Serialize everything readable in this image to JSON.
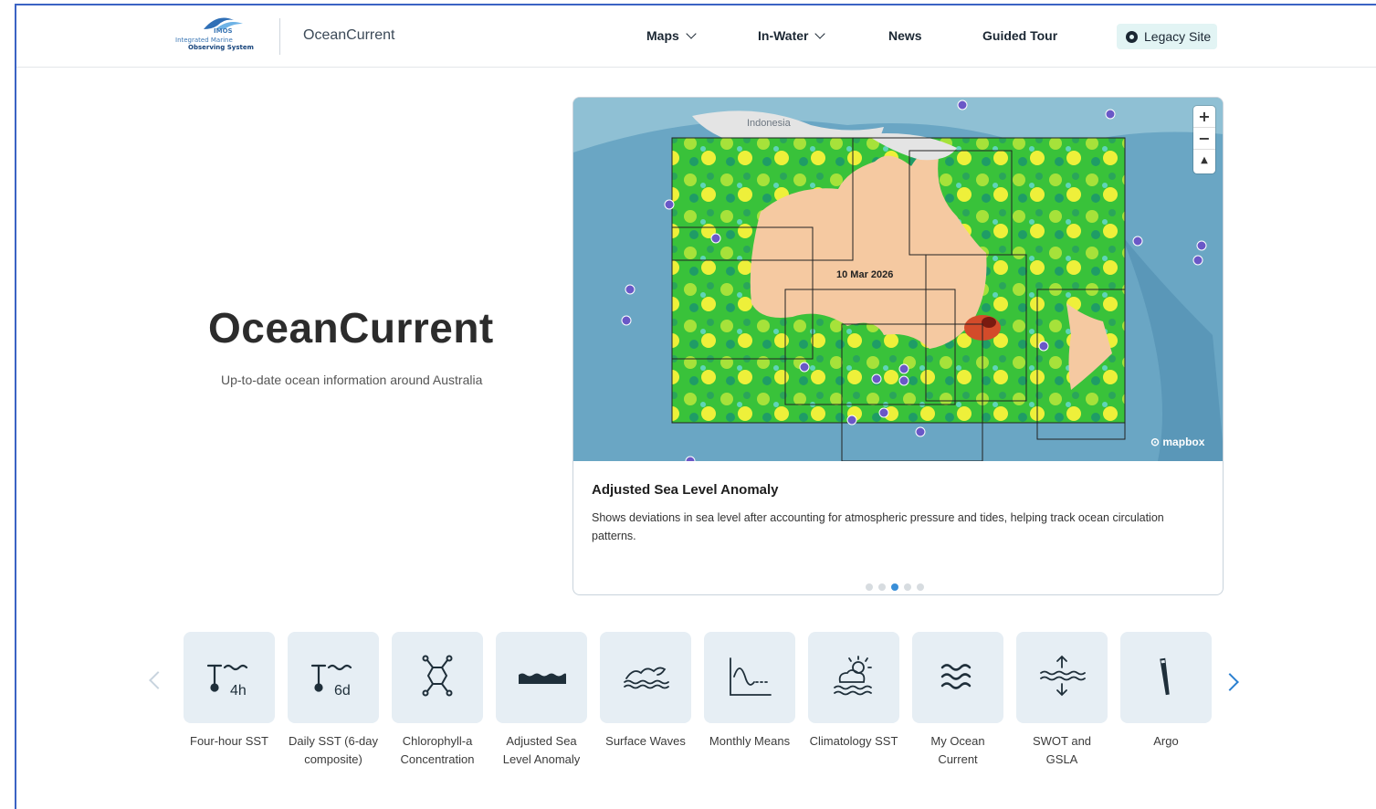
{
  "header": {
    "logo": {
      "imos": "IMOS",
      "line1": "Integrated Marine",
      "line2": "Observing System"
    },
    "brand": "OceanCurrent",
    "nav": [
      {
        "label": "Maps",
        "has_dropdown": true
      },
      {
        "label": "In-Water",
        "has_dropdown": true
      },
      {
        "label": "News",
        "has_dropdown": false
      },
      {
        "label": "Guided Tour",
        "has_dropdown": false
      }
    ],
    "legacy_label": "Legacy Site"
  },
  "hero": {
    "title": "OceanCurrent",
    "subtitle": "Up-to-date ocean information around Australia"
  },
  "card": {
    "map_label": "Indonesia",
    "map_date": "10 Mar 2026",
    "zoom_in": "+",
    "zoom_out": "−",
    "compass": "▲",
    "mapbox": "mapbox",
    "title": "Adjusted Sea Level Anomaly",
    "description": "Shows deviations in sea level after accounting for atmospheric pressure and tides, helping track ocean circulation patterns.",
    "carousel_total": 5,
    "carousel_active": 3
  },
  "products": [
    {
      "label": "Four-hour SST",
      "icon": "four-hour-sst-icon"
    },
    {
      "label": "Daily SST (6-day composite)",
      "icon": "daily-sst-icon"
    },
    {
      "label": "Chlorophyll-a Concentration",
      "icon": "chlorophyll-icon"
    },
    {
      "label": "Adjusted Sea Level Anomaly",
      "icon": "sea-level-icon"
    },
    {
      "label": "Surface Waves",
      "icon": "waves-icon"
    },
    {
      "label": "Monthly Means",
      "icon": "monthly-means-icon"
    },
    {
      "label": "Climatology SST",
      "icon": "climatology-icon"
    },
    {
      "label": "My Ocean Current",
      "icon": "my-ocean-icon"
    },
    {
      "label": "SWOT and GSLA",
      "icon": "swot-icon"
    },
    {
      "label": "Argo",
      "icon": "argo-icon"
    }
  ],
  "colors": {
    "accent": "#2a7fd0",
    "tile": "#e6eef4",
    "legacy_bg": "#e2f4f4"
  }
}
